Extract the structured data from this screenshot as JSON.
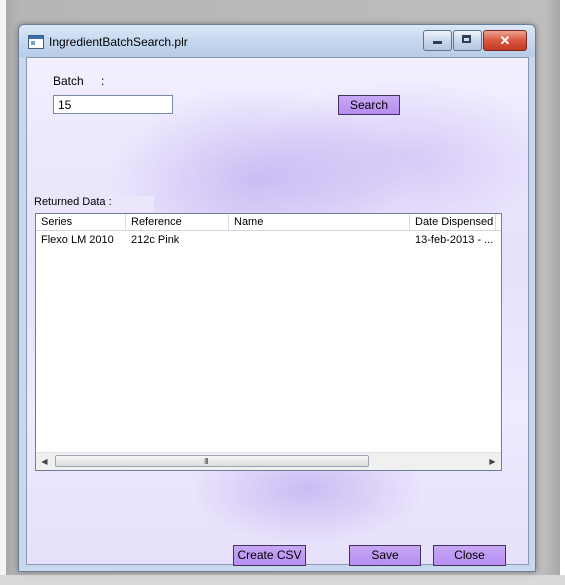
{
  "window": {
    "title": "IngredientBatchSearch.plr",
    "close_glyph": "✕"
  },
  "form": {
    "batch_label": "Batch",
    "batch_colon": ":",
    "batch_value": "15",
    "search_label": "Search",
    "returned_label": "Returned Data :"
  },
  "table": {
    "columns": [
      "Series",
      "Reference",
      "Name",
      "Date Dispensed"
    ],
    "rows": [
      [
        "Flexo LM 2010",
        "212c Pink",
        "",
        "13-feb-2013 - ..."
      ]
    ]
  },
  "scrollbar": {
    "left_arrow": "◀",
    "right_arrow": "▶",
    "grip": "III"
  },
  "footer": {
    "csv_label": "Create CSV",
    "save_label": "Save",
    "close_label": "Close"
  },
  "colors": {
    "button_fill": "#b68ef0",
    "panel_tint": "#e7e1fb"
  },
  "icons": {
    "app": "app-window-icon",
    "minimize": "minimize-icon",
    "maximize": "maximize-icon",
    "close": "close-icon"
  }
}
